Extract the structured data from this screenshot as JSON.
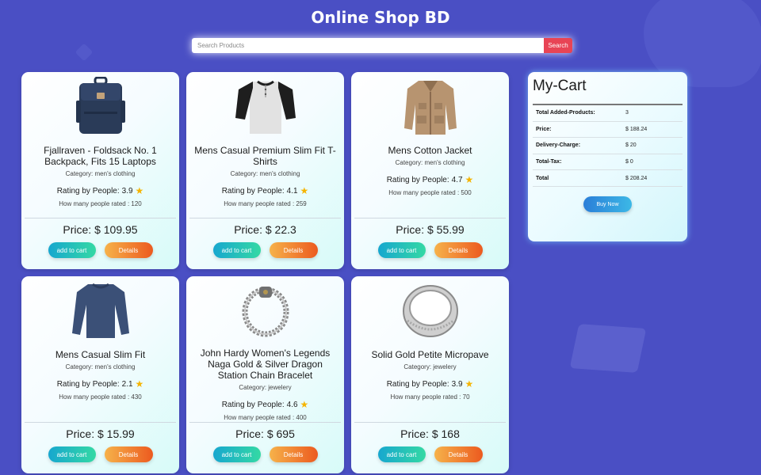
{
  "header": {
    "title": "Online Shop BD"
  },
  "search": {
    "placeholder": "Search Products",
    "button_label": "Search"
  },
  "product_labels": {
    "category_prefix": "Category: ",
    "rating_prefix": "Rating by People: ",
    "rated_prefix": "How many people rated : ",
    "price_prefix": "Price: $ ",
    "add_label": "add to cart",
    "details_label": "Details"
  },
  "products": [
    {
      "title": "Fjallraven - Foldsack No. 1 Backpack, Fits 15 Laptops",
      "category": "men's clothing",
      "rating": "3.9",
      "rated": "120",
      "price": "109.95",
      "image_icon": "backpack-icon"
    },
    {
      "title": "Mens Casual Premium Slim Fit T-Shirts",
      "category": "men's clothing",
      "rating": "4.1",
      "rated": "259",
      "price": "22.3",
      "image_icon": "tshirt-icon"
    },
    {
      "title": "Mens Cotton Jacket",
      "category": "men's clothing",
      "rating": "4.7",
      "rated": "500",
      "price": "55.99",
      "image_icon": "jacket-icon"
    },
    {
      "title": "Mens Casual Slim Fit",
      "category": "men's clothing",
      "rating": "2.1",
      "rated": "430",
      "price": "15.99",
      "image_icon": "longsleeve-icon"
    },
    {
      "title": "John Hardy Women's Legends Naga Gold & Silver Dragon Station Chain Bracelet",
      "category": "jewelery",
      "rating": "4.6",
      "rated": "400",
      "price": "695",
      "image_icon": "bracelet-icon"
    },
    {
      "title": "Solid Gold Petite Micropave",
      "category": "jewelery",
      "rating": "3.9",
      "rated": "70",
      "price": "168",
      "image_icon": "ring-icon"
    }
  ],
  "cart": {
    "title": "My-Cart",
    "rows": [
      {
        "label": "Total Added-Products:",
        "value": "3"
      },
      {
        "label": "Price:",
        "value": "$ 188.24"
      },
      {
        "label": "Delivery-Charge:",
        "value": "$ 20"
      },
      {
        "label": "Total-Tax:",
        "value": "$ 0"
      },
      {
        "label": "Total",
        "value": "$ 208.24"
      }
    ],
    "buy_label": "Buy Now"
  },
  "colors": {
    "background": "#4a4fc4",
    "search_button": "#e84455",
    "add_button": "#17a7cf",
    "details_button": "#ec5a1f",
    "buy_button": "#2a7ed8",
    "star": "#f5b400"
  }
}
